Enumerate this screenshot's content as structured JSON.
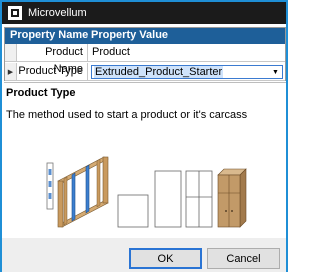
{
  "window": {
    "title": "Microvellum",
    "icon": "microvellum-app-icon"
  },
  "grid": {
    "headers": {
      "name": "Property Name",
      "value": "Property Value"
    },
    "rows": [
      {
        "name": "Product Name",
        "value": "Product"
      },
      {
        "name": "Product Type",
        "value": "Extruded_Product_Starter"
      }
    ]
  },
  "description": {
    "title": "Product Type",
    "text": "The method used to start a product or it's carcass"
  },
  "buttons": {
    "ok": "OK",
    "cancel": "Cancel"
  },
  "colors": {
    "header": "#1e5f99",
    "titlebar": "#1b1b1b",
    "border": "#1f8fd6",
    "wood": "#c8a06a"
  }
}
